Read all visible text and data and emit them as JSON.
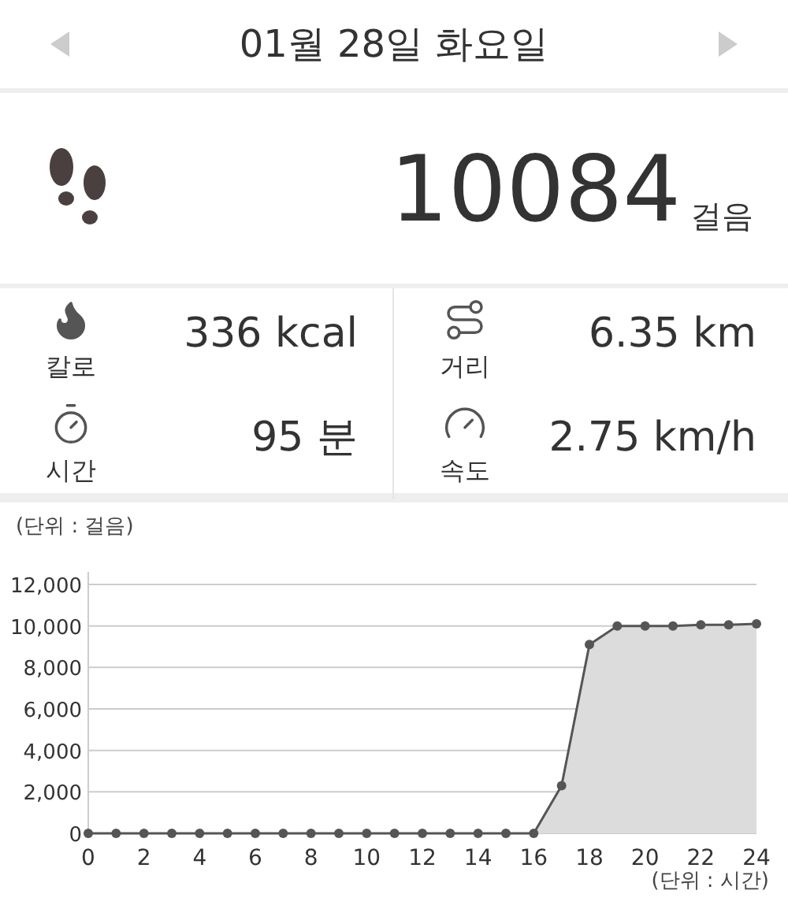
{
  "header": {
    "date": "01월 28일 화요일"
  },
  "steps": {
    "count": "10084",
    "unit": "걸음"
  },
  "stats": [
    {
      "kind": "calories",
      "label": "칼로",
      "value": "336 kcal"
    },
    {
      "kind": "distance",
      "label": "거리",
      "value": "6.35 km"
    },
    {
      "kind": "time",
      "label": "시간",
      "value": "95 분"
    },
    {
      "kind": "speed",
      "label": "속도",
      "value": "2.75 km/h"
    }
  ],
  "chart": {
    "unit_label": "(단위 : 걸음)",
    "x_unit_label": "(단위 : 시간)",
    "chart_data": {
      "type": "area",
      "x": [
        0,
        1,
        2,
        3,
        4,
        5,
        6,
        7,
        8,
        9,
        10,
        11,
        12,
        13,
        14,
        15,
        16,
        17,
        18,
        19,
        20,
        21,
        22,
        23,
        24
      ],
      "series": [
        {
          "color": "#555555",
          "values": [
            0,
            0,
            0,
            0,
            0,
            0,
            0,
            0,
            0,
            0,
            0,
            0,
            0,
            0,
            0,
            0,
            0,
            2300,
            9100,
            10000,
            10000,
            10000,
            10050,
            10050,
            10100
          ]
        }
      ],
      "grid": true,
      "xlim": [
        0,
        24
      ],
      "ylim": [
        0,
        12000
      ],
      "xticks": [
        0,
        2,
        4,
        6,
        8,
        10,
        12,
        14,
        16,
        18,
        20,
        22,
        24
      ],
      "yticks": [
        {
          "value": 0,
          "label": "0"
        },
        {
          "value": 2000,
          "label": "2,000"
        },
        {
          "value": 4000,
          "label": "4,000"
        },
        {
          "value": 6000,
          "label": "6,000"
        },
        {
          "value": 8000,
          "label": "8,000"
        },
        {
          "value": 10000,
          "label": "10,000"
        },
        {
          "value": 12000,
          "label": "12,000"
        }
      ]
    }
  }
}
